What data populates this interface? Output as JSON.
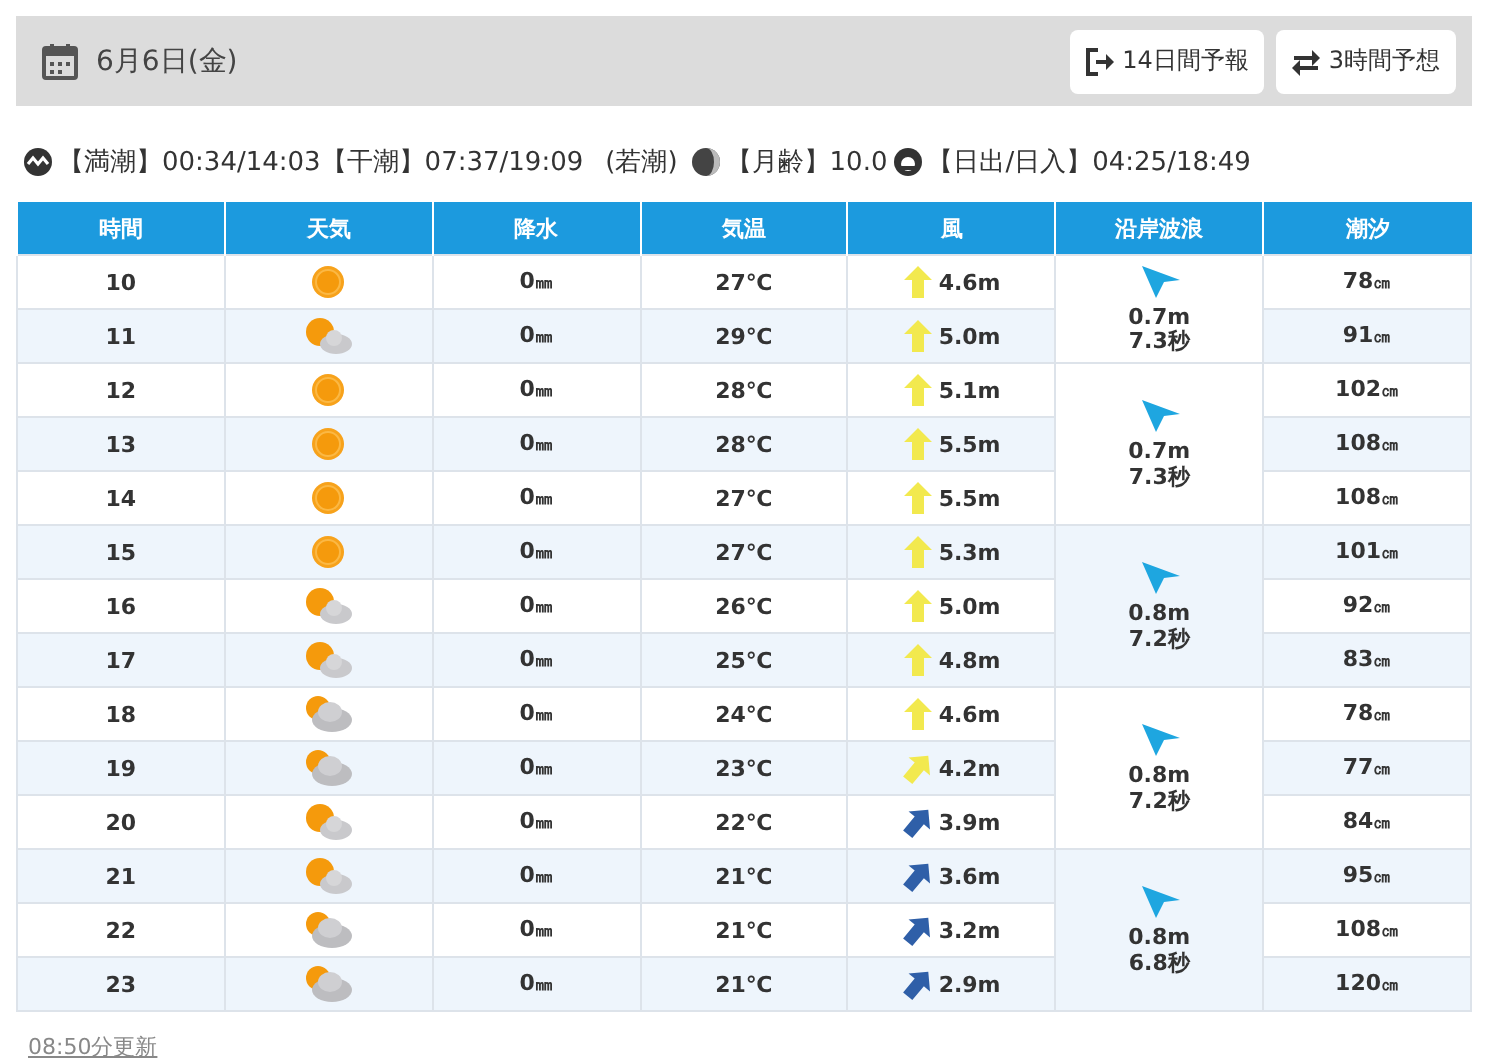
{
  "header": {
    "date": "6月6日(金)",
    "buttons": [
      {
        "label": "14日間予報",
        "kind": "exit"
      },
      {
        "label": "3時間予想",
        "kind": "swap"
      }
    ]
  },
  "tide_info": {
    "high_label": "【満潮】",
    "high": "00:34/14:03",
    "low_label": "【干潮】",
    "low": "07:37/19:09",
    "tide_type": "(若潮)",
    "moon_label": "【月齢】",
    "moon": "10.0",
    "sun_label": "【日出/日入】",
    "sun": "04:25/18:49"
  },
  "table": {
    "columns": [
      "時間",
      "天気",
      "降水",
      "気温",
      "風",
      "沿岸波浪",
      "潮汐"
    ],
    "groups": [
      {
        "wave": {
          "height": "0.7m",
          "period": "7.3秒"
        },
        "rows": [
          {
            "hour": "10",
            "weather": {
              "kind": "sunny"
            },
            "rain": "0",
            "rain_unit": "㎜",
            "temp": "27℃",
            "wind": {
              "speed": "4.6m",
              "kind": "north",
              "color": "#f2e94e"
            },
            "tide": "78",
            "tide_unit": "㎝"
          },
          {
            "hour": "11",
            "weather": {
              "kind": "partly"
            },
            "rain": "0",
            "rain_unit": "㎜",
            "temp": "29℃",
            "wind": {
              "speed": "5.0m",
              "kind": "north",
              "color": "#f2e94e"
            },
            "tide": "91",
            "tide_unit": "㎝"
          }
        ]
      },
      {
        "wave": {
          "height": "0.7m",
          "period": "7.3秒"
        },
        "rows": [
          {
            "hour": "12",
            "weather": {
              "kind": "sunny"
            },
            "rain": "0",
            "rain_unit": "㎜",
            "temp": "28℃",
            "wind": {
              "speed": "5.1m",
              "kind": "north",
              "color": "#f2e94e"
            },
            "tide": "102",
            "tide_unit": "㎝"
          },
          {
            "hour": "13",
            "weather": {
              "kind": "sunny"
            },
            "rain": "0",
            "rain_unit": "㎜",
            "temp": "28℃",
            "wind": {
              "speed": "5.5m",
              "kind": "north",
              "color": "#f2e94e"
            },
            "tide": "108",
            "tide_unit": "㎝"
          },
          {
            "hour": "14",
            "weather": {
              "kind": "sunny"
            },
            "rain": "0",
            "rain_unit": "㎜",
            "temp": "27℃",
            "wind": {
              "speed": "5.5m",
              "kind": "north",
              "color": "#f2e94e"
            },
            "tide": "108",
            "tide_unit": "㎝"
          }
        ]
      },
      {
        "wave": {
          "height": "0.8m",
          "period": "7.2秒"
        },
        "rows": [
          {
            "hour": "15",
            "weather": {
              "kind": "sunny"
            },
            "rain": "0",
            "rain_unit": "㎜",
            "temp": "27℃",
            "wind": {
              "speed": "5.3m",
              "kind": "north",
              "color": "#f2e94e"
            },
            "tide": "101",
            "tide_unit": "㎝"
          },
          {
            "hour": "16",
            "weather": {
              "kind": "partly"
            },
            "rain": "0",
            "rain_unit": "㎜",
            "temp": "26℃",
            "wind": {
              "speed": "5.0m",
              "kind": "north",
              "color": "#f2e94e"
            },
            "tide": "92",
            "tide_unit": "㎝"
          },
          {
            "hour": "17",
            "weather": {
              "kind": "partly"
            },
            "rain": "0",
            "rain_unit": "㎜",
            "temp": "25℃",
            "wind": {
              "speed": "4.8m",
              "kind": "north",
              "color": "#f2e94e"
            },
            "tide": "83",
            "tide_unit": "㎝"
          }
        ]
      },
      {
        "wave": {
          "height": "0.8m",
          "period": "7.2秒"
        },
        "rows": [
          {
            "hour": "18",
            "weather": {
              "kind": "cloudy"
            },
            "rain": "0",
            "rain_unit": "㎜",
            "temp": "24℃",
            "wind": {
              "speed": "4.6m",
              "kind": "north",
              "color": "#f2e94e"
            },
            "tide": "78",
            "tide_unit": "㎝"
          },
          {
            "hour": "19",
            "weather": {
              "kind": "cloudy"
            },
            "rain": "0",
            "rain_unit": "㎜",
            "temp": "23℃",
            "wind": {
              "speed": "4.2m",
              "kind": "northeast",
              "color": "#f2e94e"
            },
            "tide": "77",
            "tide_unit": "㎝"
          },
          {
            "hour": "20",
            "weather": {
              "kind": "partly"
            },
            "rain": "0",
            "rain_unit": "㎜",
            "temp": "22℃",
            "wind": {
              "speed": "3.9m",
              "kind": "northeast",
              "color": "#2f5fa8"
            },
            "tide": "84",
            "tide_unit": "㎝"
          }
        ]
      },
      {
        "wave": {
          "height": "0.8m",
          "period": "6.8秒"
        },
        "rows": [
          {
            "hour": "21",
            "weather": {
              "kind": "partly"
            },
            "rain": "0",
            "rain_unit": "㎜",
            "temp": "21℃",
            "wind": {
              "speed": "3.6m",
              "kind": "northeast",
              "color": "#2f5fa8"
            },
            "tide": "95",
            "tide_unit": "㎝"
          },
          {
            "hour": "22",
            "weather": {
              "kind": "cloudy"
            },
            "rain": "0",
            "rain_unit": "㎜",
            "temp": "21℃",
            "wind": {
              "speed": "3.2m",
              "kind": "northeast",
              "color": "#2f5fa8"
            },
            "tide": "108",
            "tide_unit": "㎝"
          },
          {
            "hour": "23",
            "weather": {
              "kind": "cloudy"
            },
            "rain": "0",
            "rain_unit": "㎜",
            "temp": "21℃",
            "wind": {
              "speed": "2.9m",
              "kind": "northeast",
              "color": "#2f5fa8"
            },
            "tide": "120",
            "tide_unit": "㎝"
          }
        ]
      }
    ]
  },
  "footer": {
    "updated": "08:50分更新"
  }
}
